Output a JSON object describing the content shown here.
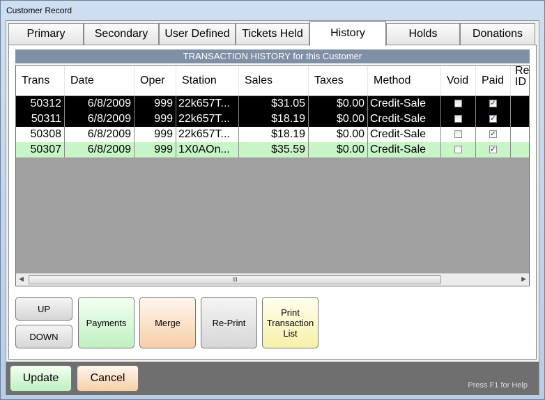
{
  "window": {
    "title": "Customer Record"
  },
  "tabs": [
    "Primary",
    "Secondary",
    "User Defined",
    "Tickets Held",
    "History",
    "Holds",
    "Donations"
  ],
  "history": {
    "header": "TRANSACTION HISTORY for this Customer",
    "columns": [
      "Trans",
      "Date",
      "Oper",
      "Station",
      "Sales",
      "Taxes",
      "Method",
      "Void",
      "Paid",
      "Ref ID"
    ],
    "rows": [
      {
        "trans": "50312",
        "date": "6/8/2009",
        "oper": "999",
        "station": "22k657T...",
        "sales": "$31.05",
        "taxes": "$0.00",
        "method": "Credit-Sale",
        "void": false,
        "paid": true,
        "style": "dark"
      },
      {
        "trans": "50311",
        "date": "6/8/2009",
        "oper": "999",
        "station": "22k657T...",
        "sales": "$18.19",
        "taxes": "$0.00",
        "method": "Credit-Sale",
        "void": false,
        "paid": true,
        "style": "dark"
      },
      {
        "trans": "50308",
        "date": "6/8/2009",
        "oper": "999",
        "station": "22k657T...",
        "sales": "$18.19",
        "taxes": "$0.00",
        "method": "Credit-Sale",
        "void": false,
        "paid": true,
        "style": "white"
      },
      {
        "trans": "50307",
        "date": "6/8/2009",
        "oper": "999",
        "station": "1X0AOn...",
        "sales": "$35.59",
        "taxes": "$0.00",
        "method": "Credit-Sale",
        "void": false,
        "paid": true,
        "style": "green"
      }
    ],
    "scroll_grip": "III"
  },
  "actions": {
    "up": "UP",
    "down": "DOWN",
    "payments": "Payments",
    "merge": "Merge",
    "reprint": "Re-Print",
    "print_list": "Print Transaction List"
  },
  "footer": {
    "update": "Update",
    "cancel": "Cancel",
    "help": "Press F1 for Help"
  },
  "colors": {
    "header_bar": "#7f8fa5",
    "selected_row": "#000000",
    "highlight_row": "#c8f5c8"
  }
}
